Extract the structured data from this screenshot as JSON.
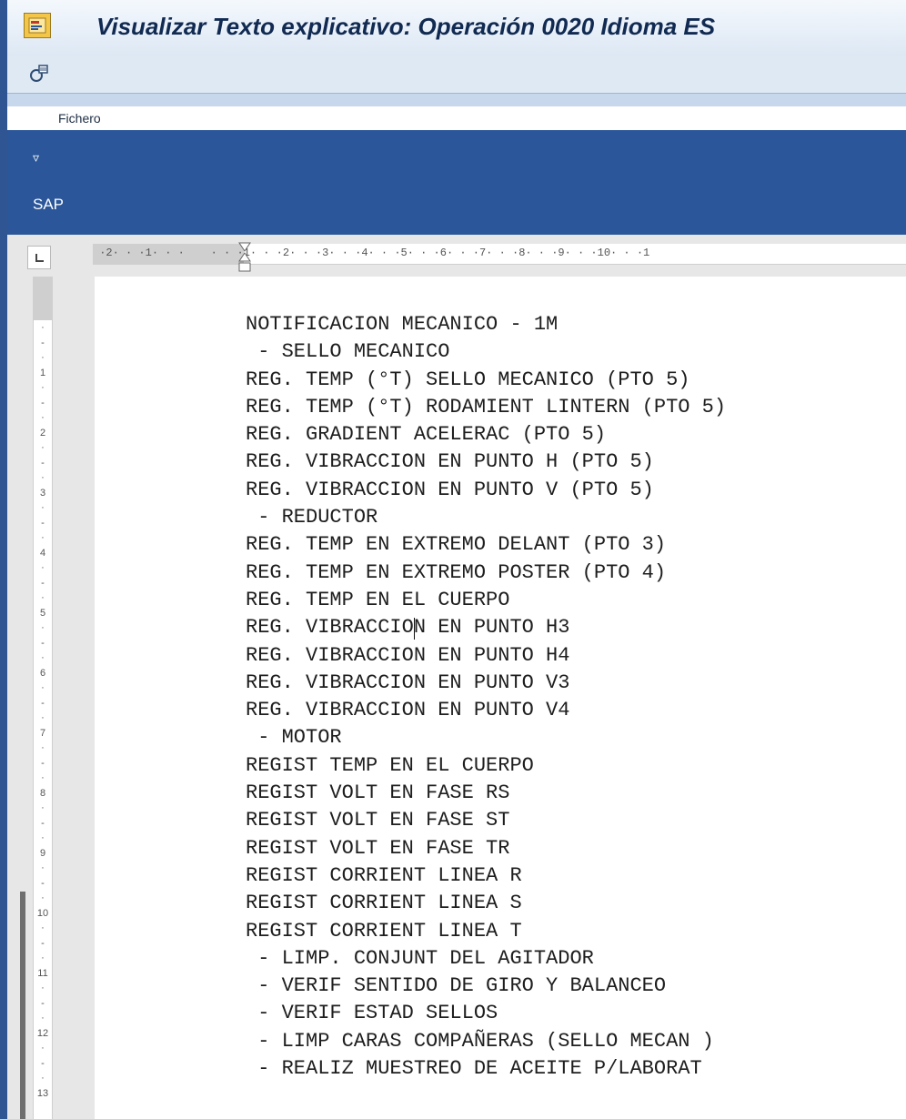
{
  "window": {
    "title": "Visualizar Texto explicativo: Operación 0020 Idioma ES",
    "app_icon": "sap-window-icon"
  },
  "toolbar": {
    "icons": [
      "customize-layout-icon"
    ]
  },
  "menu": {
    "items": [
      "Fichero"
    ]
  },
  "ribbon": {
    "qat_glyph": "▿",
    "label": "SAP",
    "color": "#2b579a"
  },
  "ruler": {
    "horizontal_marks": [
      "2",
      "1",
      "1",
      "2",
      "3",
      "4",
      "5",
      "6",
      "7",
      "8",
      "9",
      "10",
      "1"
    ],
    "vertical_marks": [
      "1",
      "2",
      "3",
      "4",
      "5",
      "6",
      "7",
      "8",
      "9",
      "10",
      "11",
      "12",
      "13"
    ]
  },
  "document": {
    "lines": [
      "NOTIFICACION MECANICO - 1M",
      " - SELLO MECANICO",
      "REG. TEMP (°T) SELLO MECANICO (PTO 5)",
      "REG. TEMP (°T) RODAMIENT LINTERN (PTO 5)",
      "REG. GRADIENT ACELERAC (PTO 5)",
      "REG. VIBRACCION EN PUNTO H (PTO 5)",
      "REG. VIBRACCION EN PUNTO V (PTO 5)",
      " - REDUCTOR",
      "REG. TEMP EN EXTREMO DELANT (PTO 3)",
      "REG. TEMP EN EXTREMO POSTER (PTO 4)",
      "REG. TEMP EN EL CUERPO",
      "REG. VIBRACCION EN PUNTO H3",
      "REG. VIBRACCION EN PUNTO H4",
      "REG. VIBRACCION EN PUNTO V3",
      "REG. VIBRACCION EN PUNTO V4",
      " - MOTOR",
      "REGIST TEMP EN EL CUERPO",
      "REGIST VOLT EN FASE RS",
      "REGIST VOLT EN FASE ST",
      "REGIST VOLT EN FASE TR",
      "REGIST CORRIENT LINEA R",
      "REGIST CORRIENT LINEA S",
      "REGIST CORRIENT LINEA T",
      " - LIMP. CONJUNT DEL AGITADOR",
      " - VERIF SENTIDO DE GIRO Y BALANCEO",
      " - VERIF ESTAD SELLOS",
      " - LIMP CARAS COMPAÑERAS (SELLO MECAN )",
      " - REALIZ MUESTREO DE ACEITE P/LABORAT"
    ]
  }
}
